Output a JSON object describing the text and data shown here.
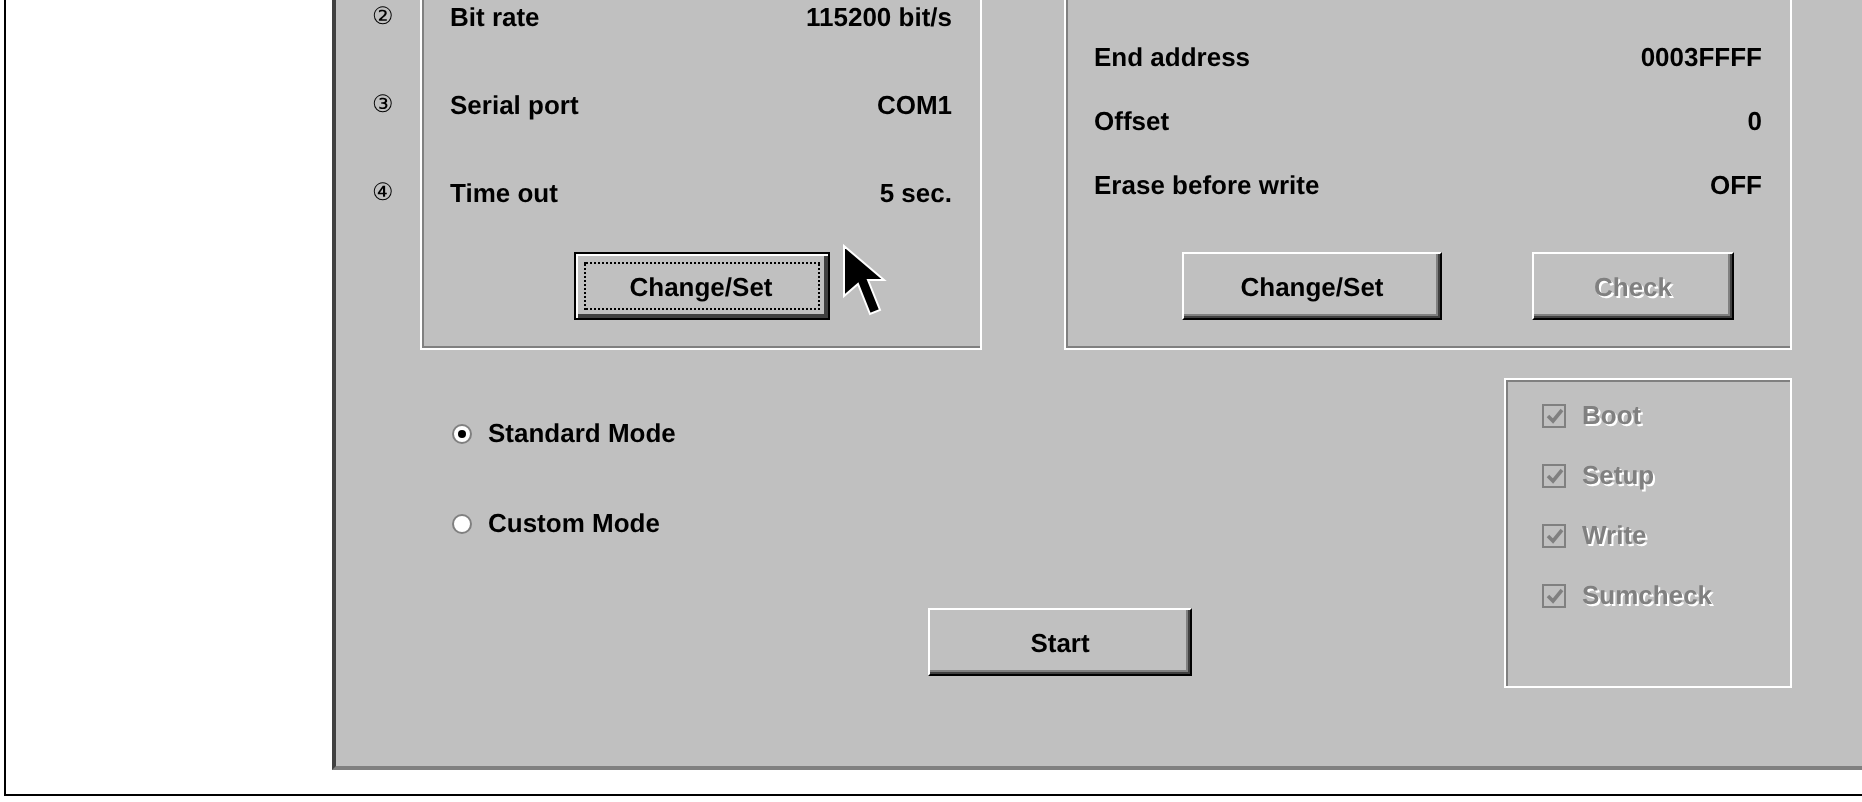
{
  "communication": {
    "rows": [
      {
        "number": "②",
        "label": "Bit rate",
        "value": "115200 bit/s"
      },
      {
        "number": "③",
        "label": "Serial port",
        "value": "COM1"
      },
      {
        "number": "④",
        "label": "Time out",
        "value": "5 sec."
      }
    ],
    "buttons": [
      {
        "label": "Change/Set",
        "focused": true,
        "disabled": false
      }
    ]
  },
  "memory": {
    "rows": [
      {
        "label": "End address",
        "value": "0003FFFF"
      },
      {
        "label": "Offset",
        "value": "0"
      },
      {
        "label": "Erase before write",
        "value": "OFF"
      }
    ],
    "buttons": [
      {
        "label": "Change/Set",
        "focused": false,
        "disabled": false
      },
      {
        "label": "Check",
        "focused": false,
        "disabled": true
      }
    ]
  },
  "modes": [
    {
      "label": "Standard Mode",
      "selected": true
    },
    {
      "label": "Custom Mode",
      "selected": false
    }
  ],
  "start_button": "Start",
  "steps": [
    {
      "label": "Boot",
      "checked": true,
      "disabled": true
    },
    {
      "label": "Setup",
      "checked": true,
      "disabled": true
    },
    {
      "label": "Write",
      "checked": true,
      "disabled": true
    },
    {
      "label": "Sumcheck",
      "checked": true,
      "disabled": true
    }
  ]
}
